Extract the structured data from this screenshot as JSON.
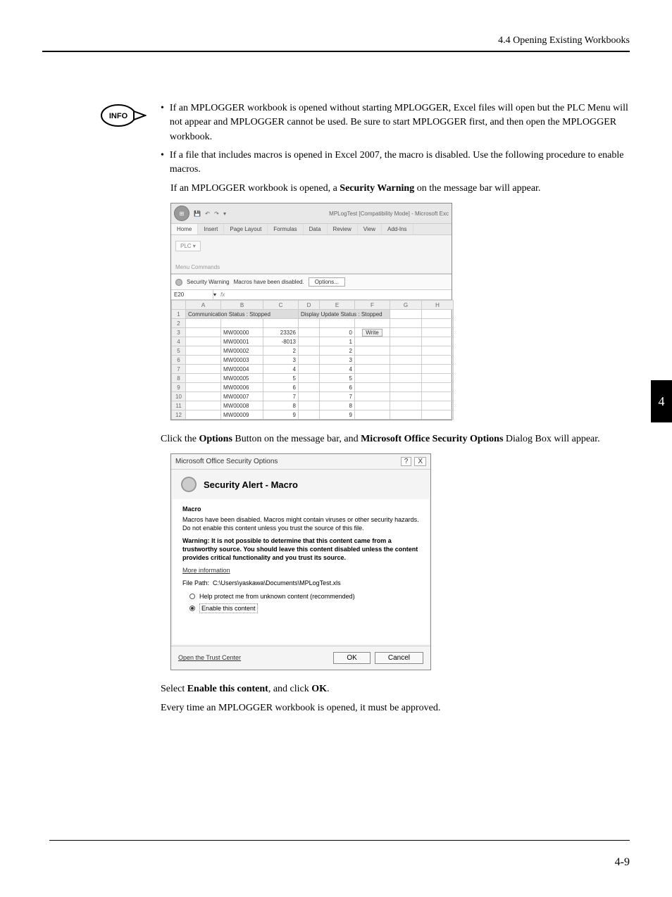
{
  "header": {
    "section": "4.4  Opening Existing Workbooks"
  },
  "info_badge": {
    "label": "INFO"
  },
  "bullets": [
    "If an MPLOGGER workbook is opened without starting MPLOGGER, Excel files will open but the PLC Menu will not appear and MPLOGGER cannot be used. Be sure to start MPLOGGER first, and then open the MPLOGGER workbook.",
    "If a file that includes macros is opened in Excel 2007, the macro is disabled. Use the following procedure to enable macros."
  ],
  "para_after_bullets": {
    "pre": "If an MPLOGGER workbook is opened, a ",
    "bold": "Security Warning",
    "post": " on the message bar will appear."
  },
  "excel": {
    "title": "MPLogTest  [Compatibility Mode]  -  Microsoft Exc",
    "tabs": [
      "Home",
      "Insert",
      "Page Layout",
      "Formulas",
      "Data",
      "Review",
      "View",
      "Add-Ins"
    ],
    "plc_btn": "PLC ▾",
    "menu_cmd": "Menu Commands",
    "msgbar_label": "Security Warning",
    "msgbar_text": "Macros have been disabled.",
    "options_btn": "Options...",
    "namebox": "E20",
    "fx_label": "fx",
    "cols": [
      "",
      "A",
      "B",
      "C",
      "D",
      "E",
      "F",
      "G",
      "H"
    ],
    "row1_a": "Communication Status : Stopped",
    "row1_e": "Display Update Status : Stopped",
    "write_btn": "Write",
    "rows": [
      {
        "n": "3",
        "b": "MW00000",
        "c": "23326",
        "e": "0"
      },
      {
        "n": "4",
        "b": "MW00001",
        "c": "-8013",
        "e": "1"
      },
      {
        "n": "5",
        "b": "MW00002",
        "c": "2",
        "e": "2"
      },
      {
        "n": "6",
        "b": "MW00003",
        "c": "3",
        "e": "3"
      },
      {
        "n": "7",
        "b": "MW00004",
        "c": "4",
        "e": "4"
      },
      {
        "n": "8",
        "b": "MW00005",
        "c": "5",
        "e": "5"
      },
      {
        "n": "9",
        "b": "MW00006",
        "c": "6",
        "e": "6"
      },
      {
        "n": "10",
        "b": "MW00007",
        "c": "7",
        "e": "7"
      },
      {
        "n": "11",
        "b": "MW00008",
        "c": "8",
        "e": "8"
      },
      {
        "n": "12",
        "b": "MW00009",
        "c": "9",
        "e": "9"
      }
    ]
  },
  "para_click_options": {
    "t1": "Click the ",
    "b1": "Options",
    "t2": " Button on the message bar, and ",
    "b2": "Microsoft Office Security Options",
    "t3": " Dialog Box will appear."
  },
  "dialog": {
    "title": "Microsoft Office Security Options",
    "alert_title": "Security Alert - Macro",
    "macro_heading": "Macro",
    "disabled_text": "Macros have been disabled. Macros might contain viruses or other security hazards. Do not enable this content unless you trust the source of this file.",
    "warning_text": "Warning: It is not possible to determine that this content came from a trustworthy source. You should leave this content disabled unless the content provides critical functionality and you trust its source.",
    "more_info": "More information",
    "file_path_label": "File Path:",
    "file_path": "C:\\Users\\yaskawa\\Documents\\MPLogTest.xls",
    "radio_protect": "Help protect me from unknown content (recommended)",
    "radio_enable": "Enable this content",
    "trust_link": "Open the Trust Center",
    "ok": "OK",
    "cancel": "Cancel",
    "close_x": "X"
  },
  "para_select": {
    "t1": "Select ",
    "b1": "Enable this content",
    "t2": ", and click ",
    "b2": "OK",
    "t3": "."
  },
  "para_every": "Every time an MPLOGGER workbook is opened, it must be approved.",
  "side_tab": "4",
  "page_num": "4-9"
}
